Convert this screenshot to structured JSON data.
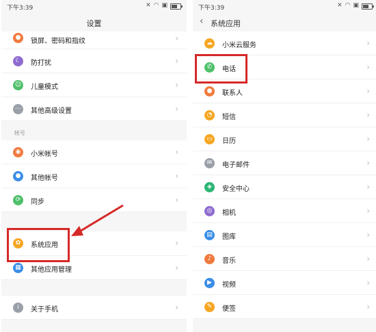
{
  "left": {
    "status_time": "下午3:39",
    "title": "设置",
    "items_top": [
      {
        "label": "锁屏、密码和指纹",
        "icon": "lock-icon",
        "color": "#f07a3e"
      },
      {
        "label": "防打扰",
        "icon": "moon-icon",
        "color": "#8e6bd0"
      },
      {
        "label": "儿童模式",
        "icon": "child-icon",
        "color": "#4ec06a"
      },
      {
        "label": "其他高级设置",
        "icon": "more-icon",
        "color": "#9aa0a8"
      }
    ],
    "section_account": "帐号",
    "items_account": [
      {
        "label": "小米帐号",
        "icon": "mi-account-icon",
        "color": "#f07a3e"
      },
      {
        "label": "其他帐号",
        "icon": "user-icon",
        "color": "#3a8ee6"
      },
      {
        "label": "同步",
        "icon": "sync-icon",
        "color": "#4ec06a"
      }
    ],
    "items_apps": [
      {
        "label": "系统应用",
        "icon": "apps-icon",
        "color": "#f5a623"
      },
      {
        "label": "其他应用管理",
        "icon": "grid-icon",
        "color": "#3a8ee6"
      }
    ],
    "items_bottom": [
      {
        "label": "关于手机",
        "icon": "info-icon",
        "color": "#9aa0a8"
      }
    ]
  },
  "right": {
    "status_time": "下午3:39",
    "title": "系统应用",
    "items": [
      {
        "label": "小米云服务",
        "icon": "cloud-icon",
        "color": "#f5a623"
      },
      {
        "label": "电话",
        "icon": "phone-icon",
        "color": "#4ec06a"
      },
      {
        "label": "联系人",
        "icon": "contact-icon",
        "color": "#f07a3e"
      },
      {
        "label": "短信",
        "icon": "message-icon",
        "color": "#f5a623"
      },
      {
        "label": "日历",
        "icon": "calendar-icon",
        "color": "#f5a623"
      },
      {
        "label": "电子邮件",
        "icon": "mail-icon",
        "color": "#9aa0a8"
      },
      {
        "label": "安全中心",
        "icon": "security-icon",
        "color": "#2bb673"
      },
      {
        "label": "相机",
        "icon": "camera-icon",
        "color": "#8e6bd0"
      },
      {
        "label": "图库",
        "icon": "gallery-icon",
        "color": "#3a8ee6"
      },
      {
        "label": "音乐",
        "icon": "music-icon",
        "color": "#f07a3e"
      },
      {
        "label": "视频",
        "icon": "video-icon",
        "color": "#3a8ee6"
      },
      {
        "label": "便签",
        "icon": "note-icon",
        "color": "#f5a623"
      }
    ]
  },
  "highlight_color": "#d62828"
}
